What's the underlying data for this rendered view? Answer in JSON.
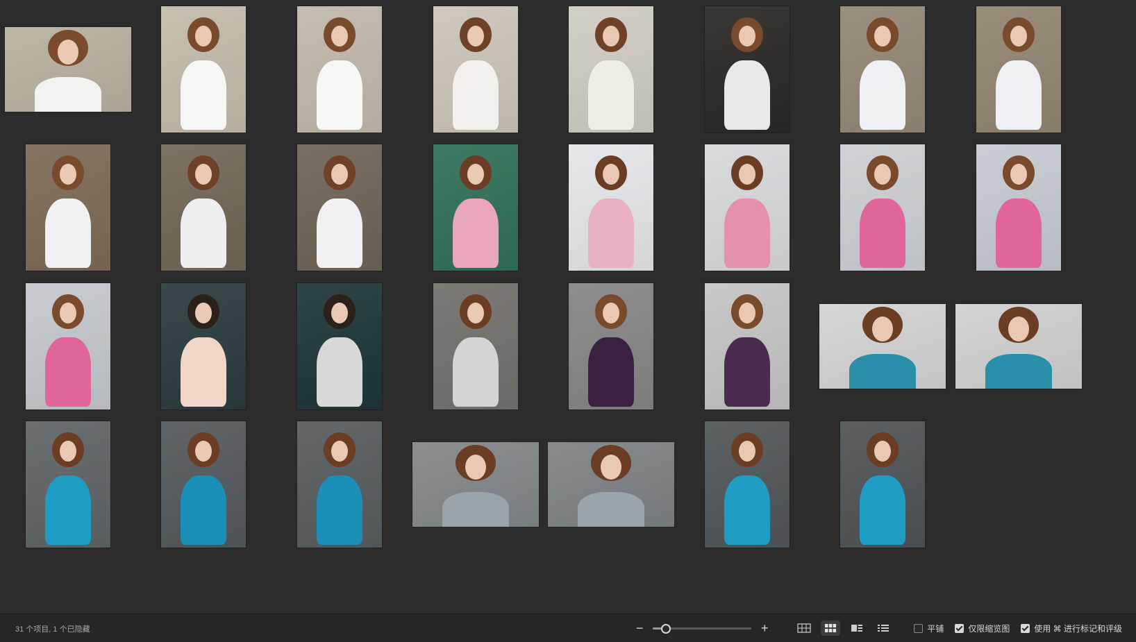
{
  "status": {
    "items_text": "31 个项目, 1 个已隐藏"
  },
  "zoom": {
    "minus": "−",
    "plus": "+",
    "level": 0.13
  },
  "views": [
    "grid-view",
    "thumbnail-view",
    "filmstrip-view",
    "list-view"
  ],
  "active_view": "thumbnail-view",
  "options": [
    {
      "label": "平铺",
      "checked": false
    },
    {
      "label": "仅限缩览图",
      "checked": true
    },
    {
      "label": "使用 ⌘ 进行标记和评级",
      "checked": true
    }
  ],
  "thumbnails": [
    {
      "o": "landscape",
      "bg": "#bdb6a6",
      "fig": "#f2f2f0",
      "hair": "#7a4a2c"
    },
    {
      "o": "portrait",
      "bg": "#c7c0b1",
      "fig": "#f6f6f4",
      "hair": "#7a4a2c"
    },
    {
      "o": "portrait",
      "bg": "#c5beb0",
      "fig": "#f6f6f4",
      "hair": "#7a4a2c"
    },
    {
      "o": "portrait",
      "bg": "#cfc9bd",
      "fig": "#f4f1ec",
      "hair": "#6e4128"
    },
    {
      "o": "portrait",
      "bg": "#d4cfc6",
      "fig": "#f0ede7",
      "hair": "#6e4128"
    },
    {
      "o": "portrait",
      "bg": "#3a3734",
      "fig": "#ece9e4",
      "hair": "#7a4a2c"
    },
    {
      "o": "portrait",
      "bg": "#9c8f7f",
      "fig": "#eef0f4",
      "hair": "#7a4a2c"
    },
    {
      "o": "portrait",
      "bg": "#9a8d7c",
      "fig": "#eef0f4",
      "hair": "#7a4a2c"
    },
    {
      "o": "portrait",
      "bg": "#857562",
      "fig": "#f1f1f3",
      "hair": "#7a4a2c"
    },
    {
      "o": "portrait",
      "bg": "#7d7163",
      "fig": "#efeff2",
      "hair": "#6e4128"
    },
    {
      "o": "portrait",
      "bg": "#7a6f62",
      "fig": "#f1f1f3",
      "hair": "#6e4128"
    },
    {
      "o": "portrait",
      "bg": "#3f7a62",
      "fig": "#e9a6b8",
      "hair": "#6b3d24"
    },
    {
      "o": "portrait",
      "bg": "#e6e7ea",
      "fig": "#e9b1bf",
      "hair": "#6b3d24"
    },
    {
      "o": "portrait",
      "bg": "#d9dbde",
      "fig": "#e590ad",
      "hair": "#6b3d24"
    },
    {
      "o": "portrait",
      "bg": "#cfd3d8",
      "fig": "#e0669a",
      "hair": "#7a4a2c"
    },
    {
      "o": "portrait",
      "bg": "#c9ced4",
      "fig": "#e0669a",
      "hair": "#7a4a2c"
    },
    {
      "o": "portrait",
      "bg": "#c8ccd1",
      "fig": "#e0669a",
      "hair": "#7a4a2c"
    },
    {
      "o": "portrait",
      "bg": "#3a4a4c",
      "fig": "#f0d6c8",
      "hair": "#2b201a"
    },
    {
      "o": "portrait",
      "bg": "#2f4446",
      "fig": "#d8d8d8",
      "hair": "#2b201a"
    },
    {
      "o": "portrait",
      "bg": "#7e7b77",
      "fig": "#d4d4d4",
      "hair": "#6b3d24"
    },
    {
      "o": "portrait",
      "bg": "#8e8e8e",
      "fig": "#3a2140",
      "hair": "#7a4a2c"
    },
    {
      "o": "portrait",
      "bg": "#c8c8c8",
      "fig": "#4a2a4e",
      "hair": "#7a4a2c"
    },
    {
      "o": "landscape",
      "bg": "#d6d6d6",
      "fig": "#2a8fa8",
      "hair": "#6b3d24"
    },
    {
      "o": "landscape",
      "bg": "#d3d3d3",
      "fig": "#2a8fa8",
      "hair": "#6b3d24"
    },
    {
      "o": "portrait",
      "bg": "#6a6f72",
      "fig": "#1f9cc4",
      "hair": "#6b3d24"
    },
    {
      "o": "portrait",
      "bg": "#5f6568",
      "fig": "#1b8fb8",
      "hair": "#6b3d24"
    },
    {
      "o": "portrait",
      "bg": "#62686b",
      "fig": "#1b8fb8",
      "hair": "#6b3d24"
    },
    {
      "o": "landscape",
      "bg": "#8a8f92",
      "fig": "#9aa4ab",
      "hair": "#6b3d24"
    },
    {
      "o": "landscape",
      "bg": "#868b8e",
      "fig": "#9aa4ab",
      "hair": "#6b3d24"
    },
    {
      "o": "portrait",
      "bg": "#5c6265",
      "fig": "#1f9cc4",
      "hair": "#6b3d24"
    },
    {
      "o": "portrait",
      "bg": "#5a6063",
      "fig": "#1f9cc4",
      "hair": "#6b3d24"
    }
  ]
}
